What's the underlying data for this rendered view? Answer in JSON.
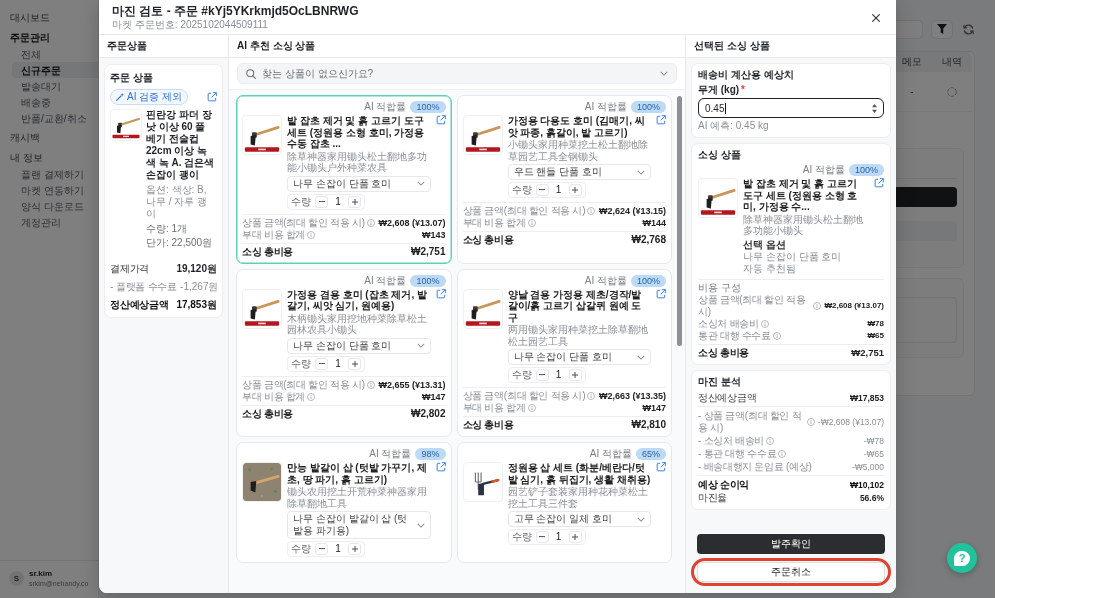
{
  "sidebar": {
    "items": [
      {
        "label": "대시보드",
        "selected": false
      },
      {
        "label": "주문관리",
        "selected": true,
        "children": [
          {
            "label": "전체",
            "selected": false
          },
          {
            "label": "신규주문",
            "selected": true
          },
          {
            "label": "발송대기",
            "selected": false
          },
          {
            "label": "배송중",
            "selected": false
          },
          {
            "label": "반품/교환/취소",
            "selected": false
          }
        ]
      },
      {
        "label": "캐시백",
        "selected": false
      },
      {
        "label": "내 정보",
        "selected": false,
        "children": [
          {
            "label": "플랜 결제하기",
            "selected": false
          },
          {
            "label": "마켓 연동하기",
            "selected": false
          },
          {
            "label": "양식 다운로드",
            "selected": false
          },
          {
            "label": "계정관리",
            "selected": false
          }
        ]
      }
    ],
    "user": {
      "avatar": "S",
      "name": "sr.kim",
      "email": "srkim@nehandy.co"
    }
  },
  "background": {
    "columns": [
      "메모",
      "내역"
    ],
    "rows": [
      {
        "cells": [
          "-"
        ]
      }
    ]
  },
  "modal": {
    "title": "마진 검토 - 주문 #kYj5YKrkmjd5OcLBNRWG",
    "subtitle": "마켓 주문번호: 2025102044509111"
  },
  "order_panel": {
    "heading": "주문상품",
    "card": {
      "heading": "주문 상품",
      "badge": "AI 검증 제외",
      "kind": "banner",
      "title": "핀란강 파더 장낫 이상 60 풀 베기 전술컵 22cm 이상 녹색 녹 A. 검은색 손잡이 괭이",
      "option": "옵션: 색상: B, 나무 / 자루 괭이",
      "quantity": "수량: 1개",
      "unit_price": "단가: 22,500원",
      "rows": [
        {
          "label": "결제가격",
          "value": "19,120원",
          "kind": "normal"
        },
        {
          "label": "- 플랫폼 수수료",
          "value": "-1,267원",
          "kind": "muted"
        },
        {
          "label": "정산예상금액",
          "value": "17,853원",
          "kind": "total"
        }
      ]
    }
  },
  "recommendations": {
    "heading": "AI 추천 소싱 상품",
    "search": {
      "placeholder": "찾는 상품이 없으신가요?"
    },
    "cards": [
      {
        "selected": true,
        "kind": "banner",
        "match_label": "AI 적합률",
        "match": "100%",
        "title": "밭 잡초 제거 및 흙 고르기 도구 세트 (정원용 소형 호미, 가정용 수동 잡초 ...",
        "subtitle": "除草神器家用锄头松土翻地多功能小锄头户外种菜农具",
        "option": "나무 손잡이 단품 호미",
        "quantity_label": "수량",
        "quantity": "1",
        "costs": [
          {
            "label": "상품 금액(최대 할인 적용 시)",
            "info": true,
            "value": "₩2,608 (¥13.07)",
            "kind": "normal"
          },
          {
            "label": "부대 비용 합계",
            "info": true,
            "value": "₩143",
            "kind": "normal"
          },
          {
            "label": "소싱 총비용",
            "info": false,
            "value": "₩2,751",
            "kind": "total"
          }
        ]
      },
      {
        "selected": false,
        "kind": "banner",
        "match_label": "AI 적합률",
        "match": "100%",
        "title": "가정용 다용도 호미 (김매기, 씨앗 파종, 흙갈이, 밭 고르기)",
        "subtitle": "小锄头家用种菜挖土松土翻地除草园艺工具全钢锄头",
        "option": "우드 핸들 단품 호미",
        "quantity_label": "수량",
        "quantity": "1",
        "costs": [
          {
            "label": "상품 금액(최대 할인 적용 시)",
            "info": true,
            "value": "₩2,624 (¥13.15)",
            "kind": "normal"
          },
          {
            "label": "부대 비용 합계",
            "info": true,
            "value": "₩144",
            "kind": "normal"
          },
          {
            "label": "소싱 총비용",
            "info": false,
            "value": "₩2,768",
            "kind": "total"
          }
        ]
      },
      {
        "selected": false,
        "kind": "banner",
        "match_label": "AI 적합률",
        "match": "100%",
        "title": "가정용 겸용 호미 (잡초 제거, 밭 갈기, 씨앗 심기, 원예용)",
        "subtitle": "木柄锄头家用挖地种菜除草松土园林农具小锄头",
        "option": "나무 손잡이 단품 호미",
        "quantity_label": "수량",
        "quantity": "1",
        "costs": [
          {
            "label": "상품 금액(최대 할인 적용 시)",
            "info": true,
            "value": "₩2,655 (¥13.31)",
            "kind": "normal"
          },
          {
            "label": "부대 비용 합계",
            "info": true,
            "value": "₩147",
            "kind": "normal"
          },
          {
            "label": "소싱 총비용",
            "info": false,
            "value": "₩2,802",
            "kind": "total"
          }
        ]
      },
      {
        "selected": false,
        "kind": "banner",
        "match_label": "AI 적합률",
        "match": "100%",
        "title": "양날 겸용 가정용 제초/경작/밭갈이/흙 고르기 삽갈퀴 원예 도구",
        "subtitle": "两用锄头家用种菜挖土除草翻地松土园艺工具",
        "option": "나무 손잡이 단품 호미",
        "quantity_label": "수량",
        "quantity": "1",
        "costs": [
          {
            "label": "상품 금액(최대 할인 적용 시)",
            "info": true,
            "value": "₩2,663 (¥13.35)",
            "kind": "normal"
          },
          {
            "label": "부대 비용 합계",
            "info": true,
            "value": "₩147",
            "kind": "normal"
          },
          {
            "label": "소싱 총비용",
            "info": false,
            "value": "₩2,810",
            "kind": "total"
          }
        ]
      },
      {
        "selected": false,
        "kind": "photo",
        "match_label": "AI 적합률",
        "match": "98%",
        "title": "만능 밭갈이 삽 (텃밭 가꾸기, 제초, 땅 파기, 흙 고르기)",
        "subtitle": "锄头农用挖土开荒种菜神器家用除草翻地工具",
        "option": "나무 손잡이 밭갈이 삽 (텃밭용 파기용)",
        "quantity_label": "수량",
        "quantity": "1"
      },
      {
        "selected": false,
        "kind": "tools",
        "match_label": "AI 적합률",
        "match": "65%",
        "title": "정원용 삽 세트 (화분/베란다/텃밭 심기, 흙 뒤집기, 생활 채취용)",
        "subtitle": "园艺铲子套装家用种花种菜松土挖土工具三件套",
        "option": "고무 손잡이 일체 호미",
        "quantity_label": "수량",
        "quantity": "1"
      }
    ]
  },
  "selected_panel": {
    "heading": "선택된 소싱 상품",
    "weight_card": {
      "heading": "배송비 계산용 예상치",
      "label": "무게 (kg)",
      "required_mark": "*",
      "value": "0.45",
      "hint": "AI 예측: 0.45 kg"
    },
    "sourcing_card": {
      "heading": "소싱 상품",
      "match_label": "AI 적합률",
      "match": "100%",
      "kind": "banner",
      "title": "밭 잡초 제거 및 흙 고르기 도구 세트 (정원용 소형 호미, 가정용 수...",
      "subtitle": "除草神器家用锄头松土翻地多功能小锄头",
      "option_heading": "선택 옵션",
      "option": "나무 손잡이 단품 호미",
      "note": "자동 추천됨",
      "costs_heading": "비용 구성",
      "costs": [
        {
          "label": "상품 금액(최대 할인 적용 시)",
          "info": true,
          "value": "₩2,608 (¥13.07)",
          "kind": "normal"
        },
        {
          "label": "소싱처 배송비",
          "info": true,
          "value": "₩78",
          "kind": "normal"
        },
        {
          "label": "통관 대행 수수료",
          "info": true,
          "value": "₩65",
          "kind": "normal"
        },
        {
          "label": "소싱 총비용",
          "info": false,
          "value": "₩2,751",
          "kind": "total"
        }
      ]
    },
    "margin_card": {
      "heading": "마진 분석",
      "rows": [
        {
          "label": "정산예상금액",
          "info": false,
          "value": "₩17,853",
          "kind": "base"
        },
        {
          "label": "- 상품 금액(최대 할인 적용 시)",
          "info": true,
          "value": "-₩2,608 (¥13.07)",
          "kind": "deduction"
        },
        {
          "label": "- 소싱처 배송비",
          "info": true,
          "value": "-₩78",
          "kind": "deduction"
        },
        {
          "label": "- 통관 대행 수수료",
          "info": true,
          "value": "-₩65",
          "kind": "deduction"
        },
        {
          "label": "- 배송대행지 운임료 (예상)",
          "info": false,
          "value": "-₩5,000",
          "kind": "deduction"
        },
        {
          "label": "예상 순이익",
          "info": false,
          "value": "₩10,102",
          "kind": "total"
        },
        {
          "label": "마진율",
          "info": false,
          "value": "56.6%",
          "kind": "base"
        }
      ]
    },
    "buttons": [
      {
        "label": "발주확인",
        "kind": "primary",
        "highlighted": false
      },
      {
        "label": "주문취소",
        "kind": "secondary",
        "highlighted": true
      }
    ]
  },
  "help_button": {
    "label": "?"
  }
}
